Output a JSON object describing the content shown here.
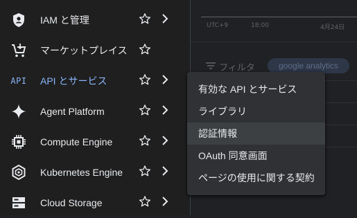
{
  "chart": {
    "ticks": [
      "UTC+9",
      "18:00",
      "4月24日"
    ]
  },
  "filter": {
    "label": "フィルタ",
    "chip": "google analytics"
  },
  "sidebar": {
    "items": [
      {
        "label": "IAM と管理",
        "icon": "shield-icon",
        "has_chevron": true
      },
      {
        "label": "マーケットプレイス",
        "icon": "cart-icon",
        "has_chevron": false
      },
      {
        "label": "API とサービス",
        "icon": "api-icon",
        "icon_text": "API",
        "has_chevron": true,
        "active": true
      },
      {
        "label": "Agent Platform",
        "icon": "sparkle-icon",
        "has_chevron": true
      },
      {
        "label": "Compute Engine",
        "icon": "chip-icon",
        "has_chevron": true
      },
      {
        "label": "Kubernetes Engine",
        "icon": "kubernetes-icon",
        "has_chevron": true
      },
      {
        "label": "Cloud Storage",
        "icon": "storage-icon",
        "has_chevron": true
      }
    ]
  },
  "submenu": {
    "items": [
      {
        "label": "有効な API とサービス"
      },
      {
        "label": "ライブラリ"
      },
      {
        "label": "認証情報",
        "hover": true
      },
      {
        "label": "OAuth 同意画面"
      },
      {
        "label": "ページの使用に関する契約"
      }
    ]
  },
  "colors": {
    "accent": "#8ab4f8",
    "sidebar_bg": "#1f1f1f",
    "menu_bg": "#303134",
    "hover_bg": "#3c4043"
  }
}
